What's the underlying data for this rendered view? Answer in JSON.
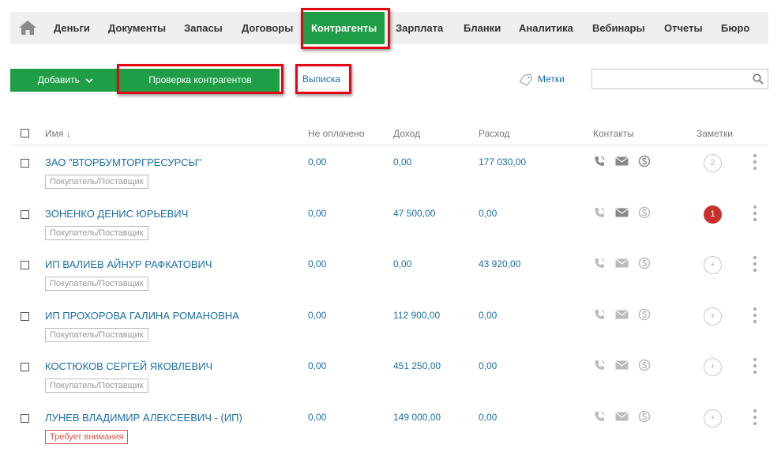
{
  "nav": {
    "items": [
      "Деньги",
      "Документы",
      "Запасы",
      "Договоры",
      "Контрагенты",
      "Зарплата",
      "Бланки",
      "Аналитика",
      "Вебинары",
      "Отчеты",
      "Бюро"
    ],
    "active": "Контрагенты"
  },
  "toolbar": {
    "add_label": "Добавить",
    "check_label": "Проверка контрагентов",
    "statement_label": "Выписка",
    "tags_label": "Метки",
    "search_placeholder": ""
  },
  "table": {
    "headers": {
      "name": "Имя ↓",
      "unpaid": "Не оплачено",
      "income": "Доход",
      "expense": "Расход",
      "contacts": "Контакты",
      "notes": "Заметки"
    },
    "rows": [
      {
        "name": "ЗАО \"ВТОРБУМТОРГРЕСУРСЫ\"",
        "badge": "Покупатель/Поставщик",
        "unpaid": "0,00",
        "income": "0,00",
        "expense": "177 030,00",
        "notes": "2"
      },
      {
        "name": "ЗОНЕНКО ДЕНИС ЮРЬЕВИЧ",
        "badge": "Покупатель/Поставщик",
        "unpaid": "0,00",
        "income": "47 500,00",
        "expense": "0,00",
        "notes": "1"
      },
      {
        "name": "ИП ВАЛИЕВ АЙНУР РАФКАТОВИЧ",
        "badge": "Покупатель/Поставщик",
        "unpaid": "0,00",
        "income": "0,00",
        "expense": "43 920,00",
        "notes": "+"
      },
      {
        "name": "ИП ПРОХОРОВА ГАЛИНА РОМАНОВНА",
        "badge": "Покупатель/Поставщик",
        "unpaid": "0,00",
        "income": "112 900,00",
        "expense": "0,00",
        "notes": "+"
      },
      {
        "name": "КОСТЮКОВ СЕРГЕЙ ЯКОВЛЕВИЧ",
        "badge": "Покупатель/Поставщик",
        "unpaid": "0,00",
        "income": "451 250,00",
        "expense": "0,00",
        "notes": "+"
      },
      {
        "name": "ЛУНЕВ ВЛАДИМИР АЛЕКСЕЕВИЧ - (ИП)",
        "badge": "Требует внимания",
        "unpaid": "0,00",
        "income": "149 000,00",
        "expense": "0,00",
        "notes": "+"
      }
    ]
  },
  "colors": {
    "accent": "#1f9e45",
    "link": "#1a6fa6",
    "highlight": "#e30613",
    "alert": "#c9302c"
  },
  "icons": [
    "home-icon",
    "chevron-down-icon",
    "tag-icon",
    "search-icon",
    "phone-icon",
    "mail-icon",
    "skype-icon",
    "kebab-icon"
  ]
}
